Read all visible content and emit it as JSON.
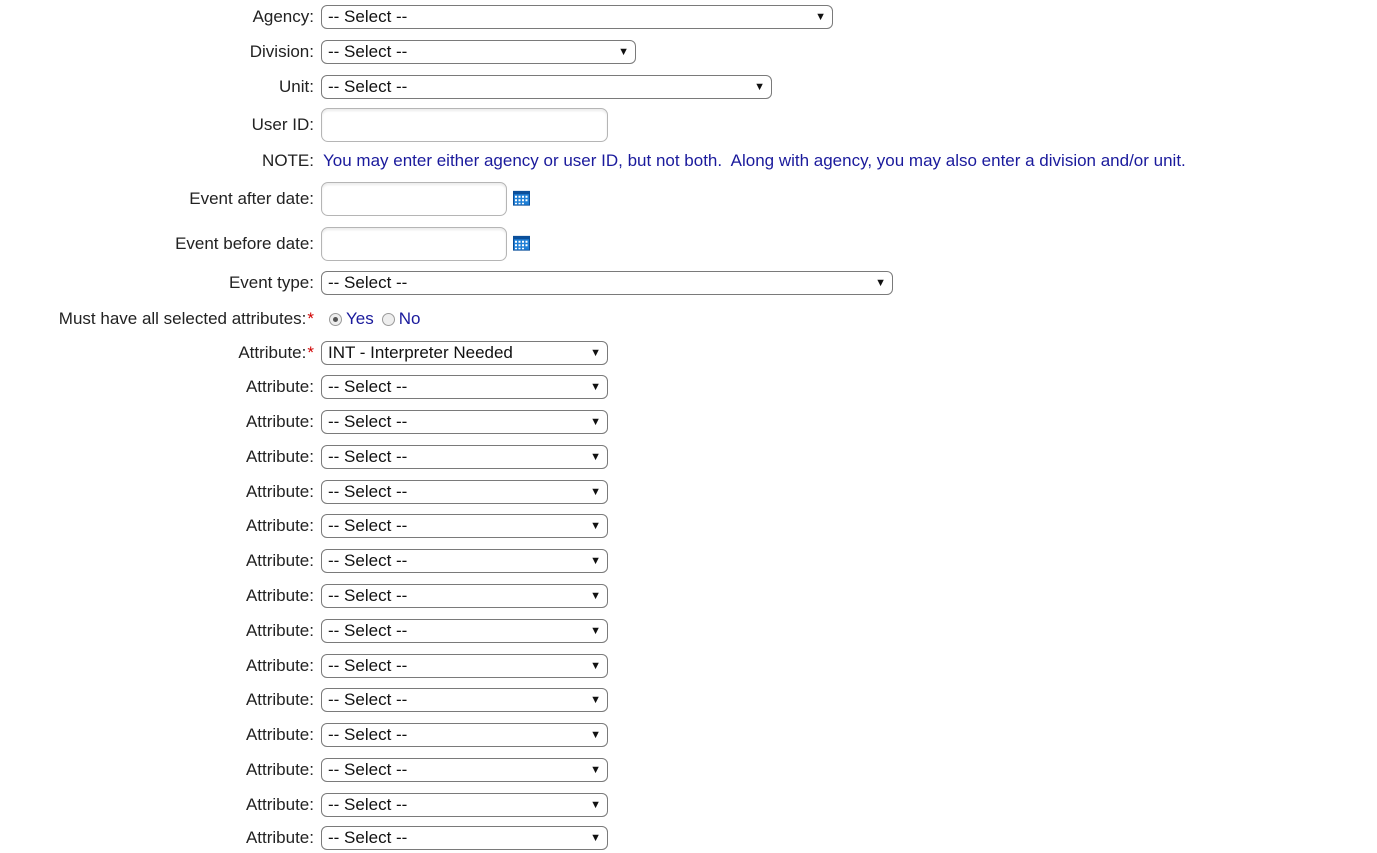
{
  "form": {
    "agency": {
      "label": "Agency:",
      "value": "-- Select --"
    },
    "division": {
      "label": "Division:",
      "value": "-- Select --"
    },
    "unit": {
      "label": "Unit:",
      "value": "-- Select --"
    },
    "user_id": {
      "label": "User ID:",
      "value": ""
    },
    "note": {
      "label": "NOTE:",
      "text": "You may enter either agency or user ID, but not both.  Along with agency, you may also enter a division and/or unit."
    },
    "event_after": {
      "label": "Event after date:",
      "value": ""
    },
    "event_before": {
      "label": "Event before date:",
      "value": ""
    },
    "event_type": {
      "label": "Event type:",
      "value": "-- Select --"
    },
    "must_have": {
      "label": "Must have all selected attributes:",
      "required_mark": "*",
      "options": [
        "Yes",
        "No"
      ],
      "selected": "Yes"
    },
    "attribute_required": {
      "label": "Attribute:",
      "required_mark": "*",
      "value": "INT - Interpreter Needed"
    },
    "attributes": [
      {
        "label": "Attribute:",
        "value": "-- Select --"
      },
      {
        "label": "Attribute:",
        "value": "-- Select --"
      },
      {
        "label": "Attribute:",
        "value": "-- Select --"
      },
      {
        "label": "Attribute:",
        "value": "-- Select --"
      },
      {
        "label": "Attribute:",
        "value": "-- Select --"
      },
      {
        "label": "Attribute:",
        "value": "-- Select --"
      },
      {
        "label": "Attribute:",
        "value": "-- Select --"
      },
      {
        "label": "Attribute:",
        "value": "-- Select --"
      },
      {
        "label": "Attribute:",
        "value": "-- Select --"
      },
      {
        "label": "Attribute:",
        "value": "-- Select --"
      },
      {
        "label": "Attribute:",
        "value": "-- Select --"
      },
      {
        "label": "Attribute:",
        "value": "-- Select --"
      },
      {
        "label": "Attribute:",
        "value": "-- Select --"
      },
      {
        "label": "Attribute:",
        "value": "-- Select --"
      }
    ]
  },
  "icons": {
    "calendar": "calendar-icon",
    "dropdown": "dropdown-arrow-icon"
  },
  "colors": {
    "link_text": "#1a1a9c",
    "required": "#d00000",
    "calendar_blue": "#1e7fd6"
  }
}
